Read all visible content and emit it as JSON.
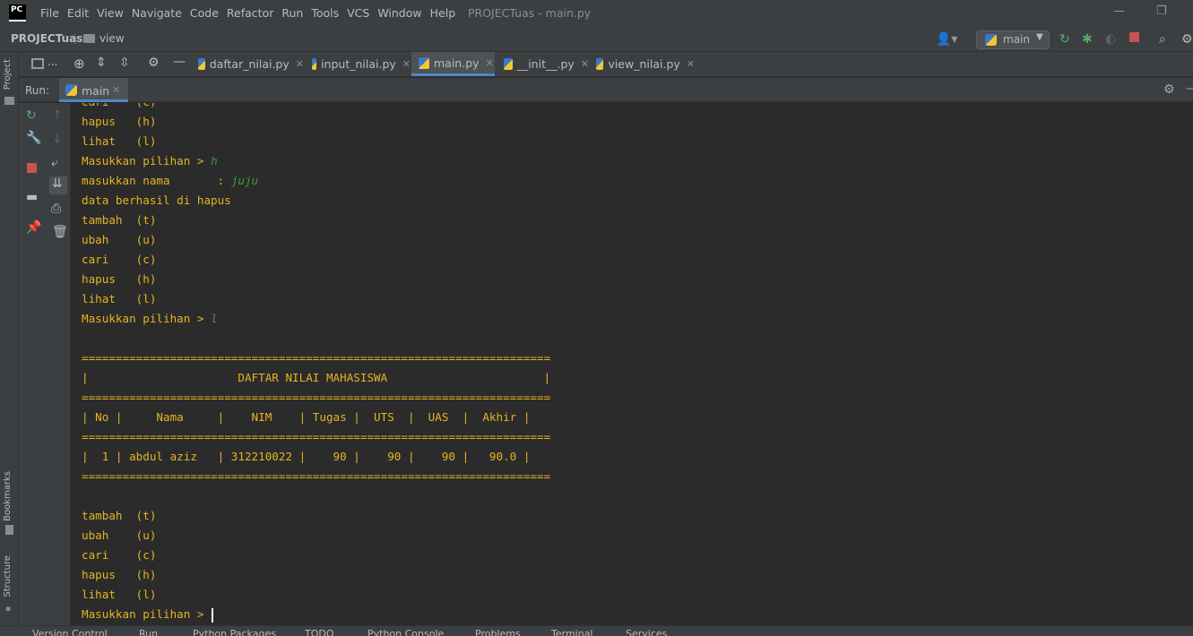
{
  "app": {
    "logo_text": "PC",
    "window_title": "PROJECTuas - main.py"
  },
  "menu": [
    "File",
    "Edit",
    "View",
    "Navigate",
    "Code",
    "Refactor",
    "Run",
    "Tools",
    "VCS",
    "Window",
    "Help"
  ],
  "breadcrumb": {
    "project": "PROJECTuas",
    "separator": "〉",
    "folder": "view"
  },
  "run_config": {
    "label": "main"
  },
  "tabs": [
    {
      "label": "daftar_nilai.py",
      "active": false
    },
    {
      "label": "input_nilai.py",
      "active": false
    },
    {
      "label": "main.py",
      "active": true
    },
    {
      "label": "__init__.py",
      "active": false
    },
    {
      "label": "view_nilai.py",
      "active": false
    }
  ],
  "tabbar_left_label": "...",
  "run_panel": {
    "label": "Run:",
    "tab_label": "main"
  },
  "side_labels": {
    "project": "Project",
    "bookmarks": "Bookmarks",
    "structure": "Structure"
  },
  "console": [
    {
      "text": "cari    (c)",
      "input": ""
    },
    {
      "text": "hapus   (h)",
      "input": ""
    },
    {
      "text": "lihat   (l)",
      "input": ""
    },
    {
      "text": "Masukkan pilihan > ",
      "input": "h"
    },
    {
      "text": "masukkan nama       : ",
      "input": "juju"
    },
    {
      "text": "data berhasil di hapus",
      "input": ""
    },
    {
      "text": "tambah  (t)",
      "input": ""
    },
    {
      "text": "ubah    (u)",
      "input": ""
    },
    {
      "text": "cari    (c)",
      "input": ""
    },
    {
      "text": "hapus   (h)",
      "input": ""
    },
    {
      "text": "lihat   (l)",
      "input": ""
    },
    {
      "text": "Masukkan pilihan > ",
      "input": "l"
    },
    {
      "text": "",
      "input": ""
    },
    {
      "text": "=====================================================================",
      "input": ""
    },
    {
      "text": "|                      DAFTAR NILAI MAHASISWA                       |",
      "input": ""
    },
    {
      "text": "=====================================================================",
      "input": ""
    },
    {
      "text": "| No |     Nama     |    NIM    | Tugas |  UTS  |  UAS  |  Akhir |",
      "input": ""
    },
    {
      "text": "=====================================================================",
      "input": ""
    },
    {
      "text": "|  1 | abdul aziz   | 312210022 |    90 |    90 |    90 |   90.0 |",
      "input": ""
    },
    {
      "text": "=====================================================================",
      "input": ""
    },
    {
      "text": "",
      "input": ""
    },
    {
      "text": "tambah  (t)",
      "input": ""
    },
    {
      "text": "ubah    (u)",
      "input": ""
    },
    {
      "text": "cari    (c)",
      "input": ""
    },
    {
      "text": "hapus   (h)",
      "input": ""
    },
    {
      "text": "lihat   (l)",
      "input": ""
    }
  ],
  "prompt_last": "Masukkan pilihan > ",
  "status_tabs": [
    "Version Control",
    "Run",
    "Python Packages",
    "TODO",
    "Python Console",
    "Problems",
    "Terminal",
    "Services"
  ]
}
